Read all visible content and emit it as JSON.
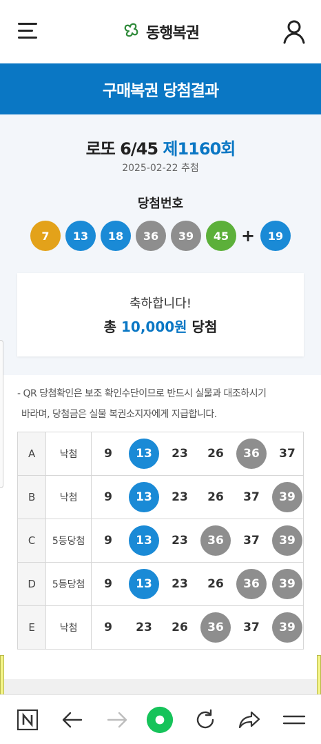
{
  "header": {
    "logo_text": "동행복권",
    "menu_icon": "hamburger-menu-icon",
    "user_icon": "user-icon"
  },
  "page_title": "구매복권 당첨결과",
  "draw": {
    "game": "로또 6/45",
    "round": "제1160회",
    "date": "2025-02-22 추첨",
    "numbers_label": "당첨번호",
    "numbers": [
      7,
      13,
      18,
      36,
      39,
      45
    ],
    "plus": "+",
    "bonus": 19
  },
  "colors": {
    "accent": "#0a77c4",
    "ball_yellow": "#e3a21a",
    "ball_blue": "#1a8ad6",
    "ball_gray": "#8e8e8e",
    "ball_green": "#5cb03a",
    "match_blue": "#1a8ad6",
    "match_gray": "#8e8e8e"
  },
  "prize": {
    "message": "축하합니다!",
    "prefix": "총",
    "amount": "10,000원",
    "suffix": "당첨"
  },
  "notice": {
    "line1": "- QR 당첨확인은 보조 확인수단이므로 반드시 실물과 대조하시기",
    "line2": "바라며, 당첨금은 실물 복권소지자에게 지급합니다."
  },
  "ticket": [
    {
      "label": "A",
      "result": "낙첨",
      "numbers": [
        9,
        13,
        23,
        26,
        36,
        37
      ],
      "marks": [
        "",
        "blue",
        "",
        "",
        "gray",
        ""
      ]
    },
    {
      "label": "B",
      "result": "낙첨",
      "numbers": [
        9,
        13,
        23,
        26,
        37,
        39
      ],
      "marks": [
        "",
        "blue",
        "",
        "",
        "",
        "gray"
      ]
    },
    {
      "label": "C",
      "result": "5등당첨",
      "numbers": [
        9,
        13,
        23,
        36,
        37,
        39
      ],
      "marks": [
        "",
        "blue",
        "",
        "gray",
        "",
        "gray"
      ]
    },
    {
      "label": "D",
      "result": "5등당첨",
      "numbers": [
        9,
        13,
        23,
        26,
        36,
        39
      ],
      "marks": [
        "",
        "blue",
        "",
        "",
        "gray",
        "gray"
      ]
    },
    {
      "label": "E",
      "result": "낙첨",
      "numbers": [
        9,
        23,
        26,
        36,
        37,
        39
      ],
      "marks": [
        "",
        "",
        "",
        "gray",
        "",
        "gray"
      ]
    }
  ],
  "browser_bar": {
    "items": [
      "naver-n-icon",
      "back-arrow-icon",
      "forward-arrow-icon",
      "home-dot-icon",
      "refresh-icon",
      "share-icon",
      "menu-lines-icon"
    ]
  }
}
